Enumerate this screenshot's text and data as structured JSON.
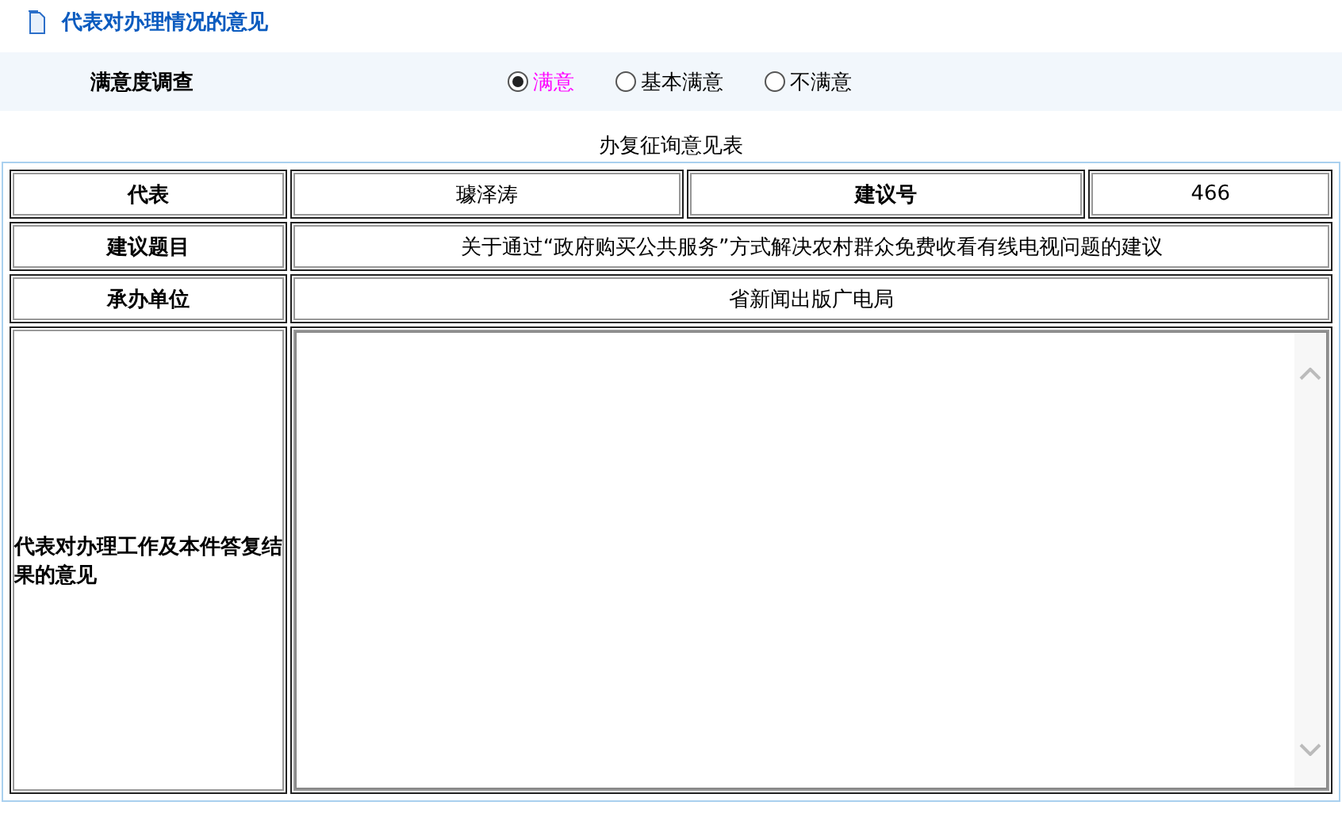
{
  "header": {
    "title": "代表对办理情况的意见"
  },
  "survey": {
    "label": "满意度调查",
    "options": [
      {
        "label": "满意",
        "selected": true
      },
      {
        "label": "基本满意",
        "selected": false
      },
      {
        "label": "不满意",
        "selected": false
      }
    ]
  },
  "form": {
    "title": "办复征询意见表",
    "representative": {
      "label": "代表",
      "value": "璩泽涛"
    },
    "proposal_number": {
      "label": "建议号",
      "value": "466"
    },
    "subject": {
      "label": "建议题目",
      "value": "关于通过“政府购买公共服务”方式解决农村群众免费收看有线电视问题的建议"
    },
    "handling_unit": {
      "label": "承办单位",
      "value": "省新闻出版广电局"
    },
    "opinion": {
      "label": "代表对办理工作及本件答复结果的意见"
    }
  }
}
